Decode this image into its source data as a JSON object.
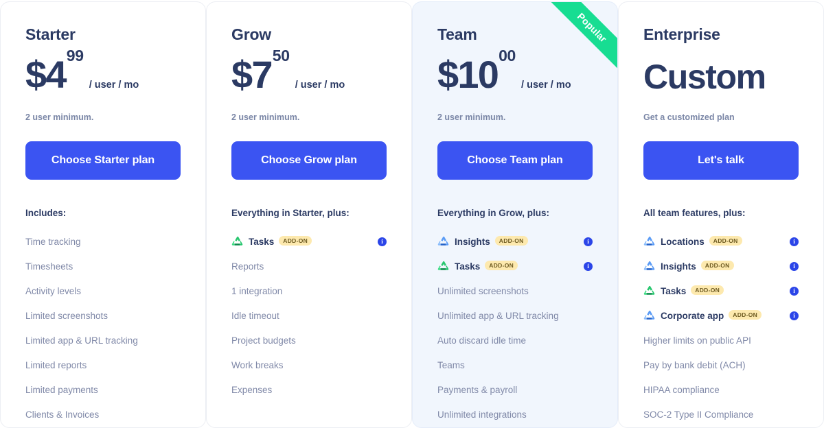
{
  "colors": {
    "accent_button": "#3b54f2",
    "ribbon_green": "#17dd92",
    "addon_badge_bg": "#fde9ae",
    "info_icon_blue": "#2b45e8",
    "featured_card_bg": "#f1f6fd",
    "heading_navy": "#2b3a63",
    "feature_text": "#8089a8",
    "icon_green": "#22c55e",
    "icon_blue": "#3b82f6"
  },
  "plans": [
    {
      "name": "Starter",
      "price_symbol": "$",
      "price_main": "4",
      "price_cents": "99",
      "price_unit": "/ user / mo",
      "price_note": "2 user minimum.",
      "cta_label": "Choose Starter plan",
      "features_heading": "Includes:",
      "featured": false,
      "ribbon_label": "",
      "features": [
        {
          "label": "Time tracking",
          "addon": false,
          "icon": "",
          "badge": "",
          "info": false
        },
        {
          "label": "Timesheets",
          "addon": false,
          "icon": "",
          "badge": "",
          "info": false
        },
        {
          "label": "Activity levels",
          "addon": false,
          "icon": "",
          "badge": "",
          "info": false
        },
        {
          "label": "Limited screenshots",
          "addon": false,
          "icon": "",
          "badge": "",
          "info": false
        },
        {
          "label": "Limited app & URL tracking",
          "addon": false,
          "icon": "",
          "badge": "",
          "info": false
        },
        {
          "label": "Limited reports",
          "addon": false,
          "icon": "",
          "badge": "",
          "info": false
        },
        {
          "label": "Limited payments",
          "addon": false,
          "icon": "",
          "badge": "",
          "info": false
        },
        {
          "label": "Clients & Invoices",
          "addon": false,
          "icon": "",
          "badge": "",
          "info": false
        }
      ]
    },
    {
      "name": "Grow",
      "price_symbol": "$",
      "price_main": "7",
      "price_cents": "50",
      "price_unit": "/ user / mo",
      "price_note": "2 user minimum.",
      "cta_label": "Choose Grow plan",
      "features_heading": "Everything in Starter, plus:",
      "featured": false,
      "ribbon_label": "",
      "features": [
        {
          "label": "Tasks",
          "addon": true,
          "icon": "tasks-logo-icon",
          "badge": "ADD-ON",
          "info": true
        },
        {
          "label": "Reports",
          "addon": false,
          "icon": "",
          "badge": "",
          "info": false
        },
        {
          "label": "1 integration",
          "addon": false,
          "icon": "",
          "badge": "",
          "info": false
        },
        {
          "label": "Idle timeout",
          "addon": false,
          "icon": "",
          "badge": "",
          "info": false
        },
        {
          "label": "Project budgets",
          "addon": false,
          "icon": "",
          "badge": "",
          "info": false
        },
        {
          "label": "Work breaks",
          "addon": false,
          "icon": "",
          "badge": "",
          "info": false
        },
        {
          "label": "Expenses",
          "addon": false,
          "icon": "",
          "badge": "",
          "info": false
        }
      ]
    },
    {
      "name": "Team",
      "price_symbol": "$",
      "price_main": "10",
      "price_cents": "00",
      "price_unit": "/ user / mo",
      "price_note": "2 user minimum.",
      "cta_label": "Choose Team plan",
      "features_heading": "Everything in Grow, plus:",
      "featured": true,
      "ribbon_label": "Popular",
      "features": [
        {
          "label": "Insights",
          "addon": true,
          "icon": "insights-logo-icon",
          "badge": "ADD-ON",
          "info": true
        },
        {
          "label": "Tasks",
          "addon": true,
          "icon": "tasks-logo-icon",
          "badge": "ADD-ON",
          "info": true
        },
        {
          "label": "Unlimited screenshots",
          "addon": false,
          "icon": "",
          "badge": "",
          "info": false
        },
        {
          "label": "Unlimited app & URL tracking",
          "addon": false,
          "icon": "",
          "badge": "",
          "info": false
        },
        {
          "label": "Auto discard idle time",
          "addon": false,
          "icon": "",
          "badge": "",
          "info": false
        },
        {
          "label": "Teams",
          "addon": false,
          "icon": "",
          "badge": "",
          "info": false
        },
        {
          "label": "Payments & payroll",
          "addon": false,
          "icon": "",
          "badge": "",
          "info": false
        },
        {
          "label": "Unlimited integrations",
          "addon": false,
          "icon": "",
          "badge": "",
          "info": false
        }
      ]
    },
    {
      "name": "Enterprise",
      "price_symbol": "",
      "price_main": "Custom",
      "price_cents": "",
      "price_unit": "",
      "price_note": "Get a customized plan",
      "cta_label": "Let's talk",
      "features_heading": "All team features, plus:",
      "featured": false,
      "ribbon_label": "",
      "features": [
        {
          "label": "Locations",
          "addon": true,
          "icon": "locations-logo-icon",
          "badge": "ADD-ON",
          "info": true
        },
        {
          "label": "Insights",
          "addon": true,
          "icon": "insights-logo-icon",
          "badge": "ADD-ON",
          "info": true
        },
        {
          "label": "Tasks",
          "addon": true,
          "icon": "tasks-logo-icon",
          "badge": "ADD-ON",
          "info": true
        },
        {
          "label": "Corporate app",
          "addon": true,
          "icon": "corporate-app-logo-icon",
          "badge": "ADD-ON",
          "info": true
        },
        {
          "label": "Higher limits on public API",
          "addon": false,
          "icon": "",
          "badge": "",
          "info": false
        },
        {
          "label": "Pay by bank debit (ACH)",
          "addon": false,
          "icon": "",
          "badge": "",
          "info": false
        },
        {
          "label": "HIPAA compliance",
          "addon": false,
          "icon": "",
          "badge": "",
          "info": false
        },
        {
          "label": "SOC-2 Type II Compliance",
          "addon": false,
          "icon": "",
          "badge": "",
          "info": false
        }
      ]
    }
  ],
  "info_icon_glyph": "i"
}
